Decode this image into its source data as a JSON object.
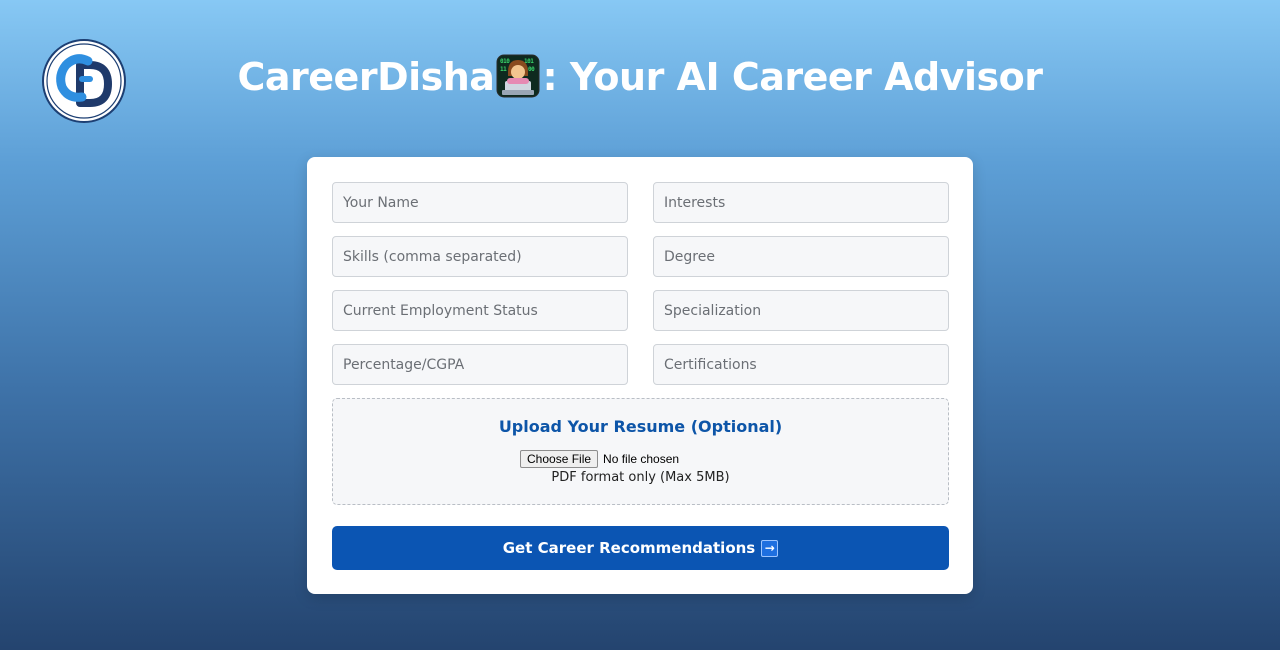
{
  "header": {
    "logo_icon": "cd-logo-icon",
    "title_prefix": "CareerDisha",
    "title_icon": "technologist-emoji-icon",
    "title_suffix": ": Your AI Career Advisor"
  },
  "form": {
    "name_placeholder": "Your Name",
    "interests_placeholder": "Interests",
    "skills_placeholder": "Skills (comma separated)",
    "degree_placeholder": "Degree",
    "employment_placeholder": "Current Employment Status",
    "specialization_placeholder": "Specialization",
    "percentage_placeholder": "Percentage/CGPA",
    "certifications_placeholder": "Certifications"
  },
  "upload": {
    "title": "Upload Your Resume (Optional)",
    "choose_label": "Choose File",
    "file_status": "No file chosen",
    "hint": "PDF format only (Max 5MB)"
  },
  "submit": {
    "label": "Get Career Recommendations",
    "icon": "right-arrow-icon",
    "arrow": "→"
  },
  "colors": {
    "brand_blue": "#0b55b3",
    "upload_title": "#0d55a8"
  }
}
